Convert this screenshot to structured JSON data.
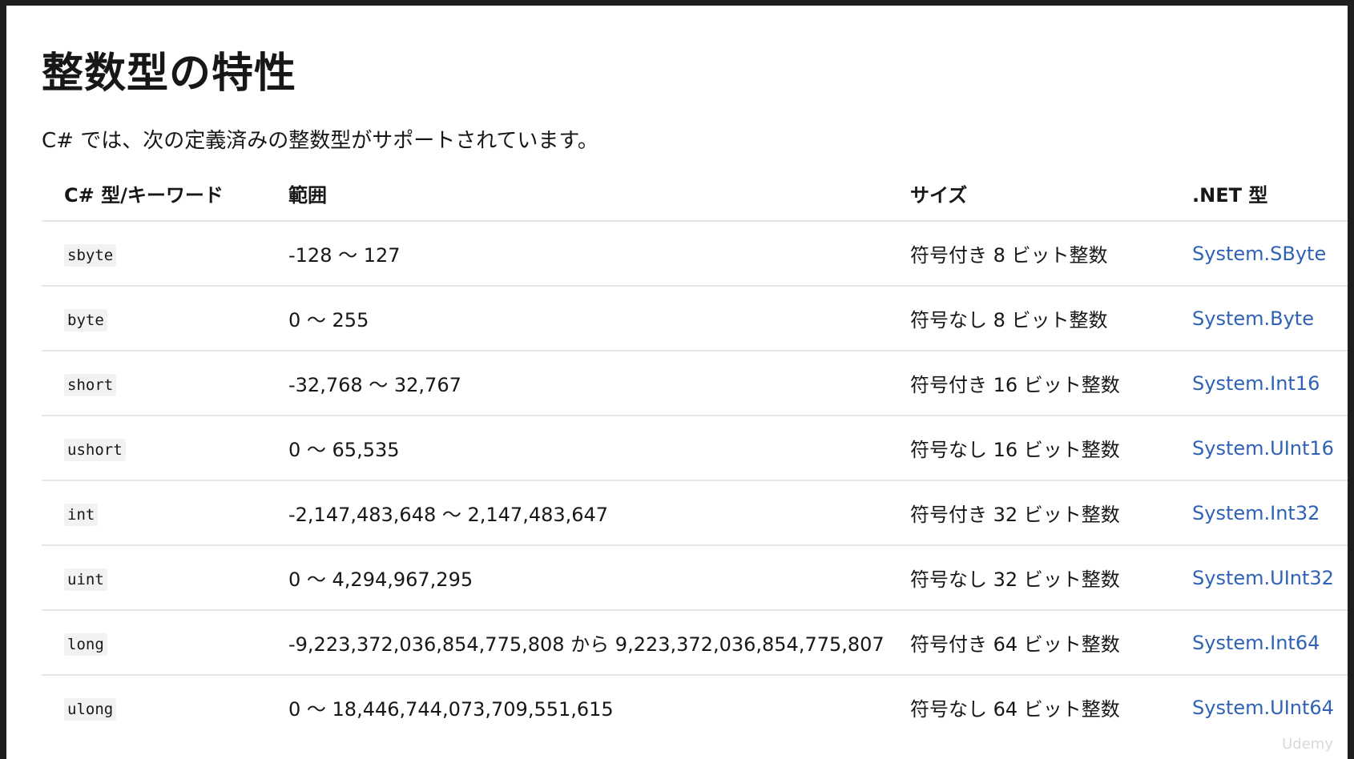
{
  "page": {
    "title": "整数型の特性",
    "intro": "C# では、次の定義済みの整数型がサポートされています。"
  },
  "table": {
    "headers": {
      "keyword": "C# 型/キーワード",
      "range": "範囲",
      "size": "サイズ",
      "net_type": ".NET 型"
    },
    "rows": [
      {
        "keyword": "sbyte",
        "range": "-128 ～ 127",
        "size": "符号付き 8 ビット整数",
        "net_type": "System.SByte"
      },
      {
        "keyword": "byte",
        "range": "0 ～ 255",
        "size": "符号なし 8 ビット整数",
        "net_type": "System.Byte"
      },
      {
        "keyword": "short",
        "range": "-32,768 ～ 32,767",
        "size": "符号付き 16 ビット整数",
        "net_type": "System.Int16"
      },
      {
        "keyword": "ushort",
        "range": "0 ～ 65,535",
        "size": "符号なし 16 ビット整数",
        "net_type": "System.UInt16"
      },
      {
        "keyword": "int",
        "range": "-2,147,483,648 ～ 2,147,483,647",
        "size": "符号付き 32 ビット整数",
        "net_type": "System.Int32"
      },
      {
        "keyword": "uint",
        "range": "0 ～ 4,294,967,295",
        "size": "符号なし 32 ビット整数",
        "net_type": "System.UInt32"
      },
      {
        "keyword": "long",
        "range": "-9,223,372,036,854,775,808 から 9,223,372,036,854,775,807",
        "size": "符号付き 64 ビット整数",
        "net_type": "System.Int64"
      },
      {
        "keyword": "ulong",
        "range": "0 ～ 18,446,744,073,709,551,615",
        "size": "符号なし 64 ビット整数",
        "net_type": "System.UInt64"
      }
    ]
  },
  "watermark": "Udemy",
  "colors": {
    "link": "#2f62b5",
    "text": "#171717",
    "border": "#e6e6e6",
    "code_bg": "#f2f2f2"
  }
}
